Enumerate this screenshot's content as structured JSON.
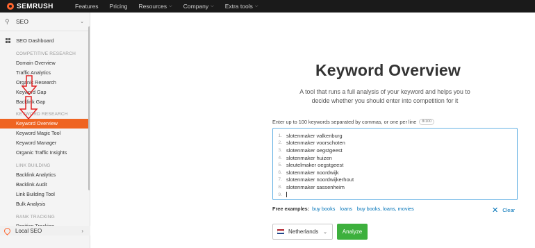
{
  "topnav": {
    "logo": "SEMRUSH",
    "items": [
      {
        "label": "Features",
        "dropdown": false
      },
      {
        "label": "Pricing",
        "dropdown": false
      },
      {
        "label": "Resources",
        "dropdown": true
      },
      {
        "label": "Company",
        "dropdown": true
      },
      {
        "label": "Extra tools",
        "dropdown": true
      }
    ]
  },
  "sidebar": {
    "toolkit": "SEO",
    "dashboard": "SEO Dashboard",
    "sections": [
      {
        "title": "COMPETITIVE RESEARCH",
        "items": [
          "Domain Overview",
          "Traffic Analytics",
          "Organic Research",
          "Keyword Gap",
          "Backlink Gap"
        ]
      },
      {
        "title": "KEYWORD RESEARCH",
        "items": [
          "Keyword Overview",
          "Keyword Magic Tool",
          "Keyword Manager",
          "Organic Traffic Insights"
        ]
      },
      {
        "title": "LINK BUILDING",
        "items": [
          "Backlink Analytics",
          "Backlink Audit",
          "Link Building Tool",
          "Bulk Analysis"
        ]
      },
      {
        "title": "RANK TRACKING",
        "items": [
          "Position Tracking"
        ]
      }
    ],
    "active_item": "Keyword Overview",
    "local_seo": "Local SEO"
  },
  "main": {
    "title": "Keyword Overview",
    "subtitle": "A tool that runs a full analysis of your keyword and helps you to decide whether you should enter into competition for it",
    "input_label": "Enter up to 100 keywords separated by commas, or one per line",
    "counter": "8/100",
    "keywords": [
      "slotenmaker valkenburg",
      "slotenmaker voorschoten",
      "slotenmaker oegstgeest",
      "slotenmaker huizen",
      "sleutelmaker oegstgeest",
      "slotenmaker noordwijk",
      "slotenmaker noordwijkerhout",
      "slotenmaker sassenheim",
      ""
    ],
    "free_examples_label": "Free examples:",
    "examples": [
      "buy books",
      "loans",
      "buy books, loans, movies"
    ],
    "clear_label": "Clear",
    "database": "Netherlands",
    "analyze_label": "Analyze"
  },
  "colors": {
    "topbar": "#1a1a1a",
    "brand_orange": "#ff642d",
    "active_item": "#ef6421",
    "link": "#0073b8",
    "analyze": "#3db03d",
    "annotation_red": "#e02020",
    "focus_border": "#66b2e4"
  },
  "icons": [
    "semrush-logo-icon",
    "seo-toolkit-icon",
    "chevron-down-icon",
    "dashboard-grid-icon",
    "location-pin-icon",
    "chevron-right-icon",
    "close-icon",
    "netherlands-flag-icon"
  ]
}
